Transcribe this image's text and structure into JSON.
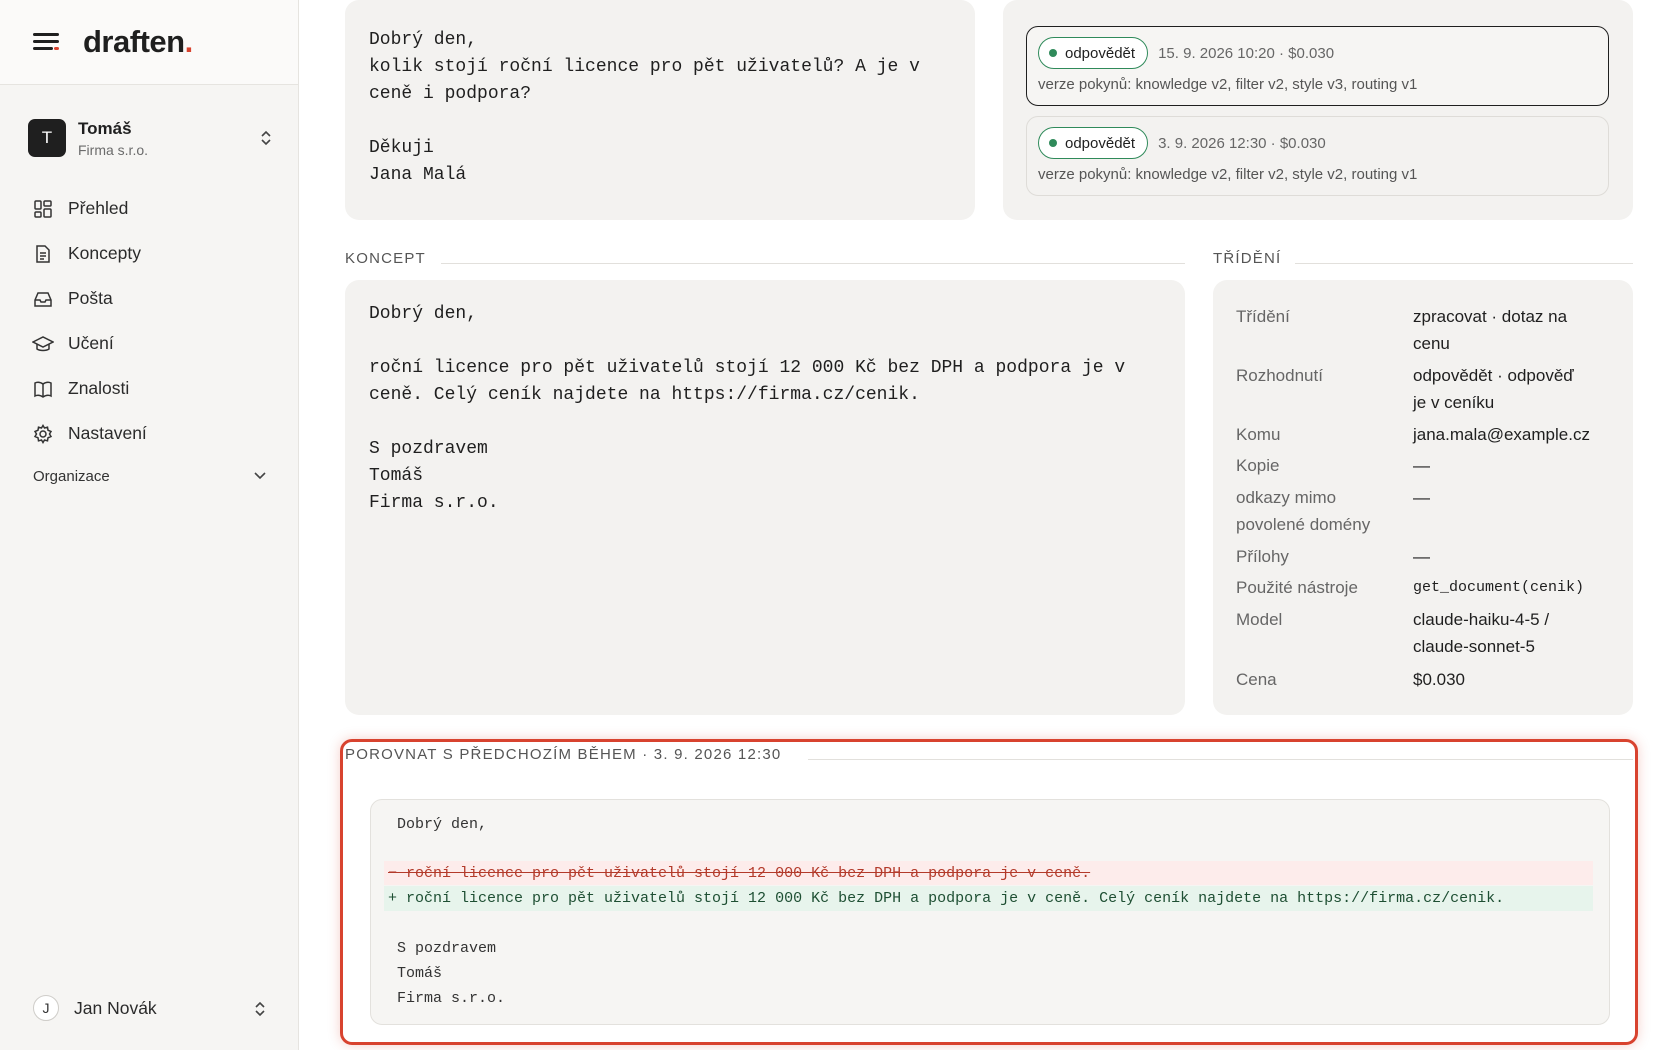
{
  "app": {
    "logo": "draften",
    "logo_dot": "."
  },
  "org": {
    "initial": "T",
    "name": "Tomáš",
    "company": "Firma s.r.o."
  },
  "nav": [
    {
      "label": "Přehled",
      "icon": "dashboard-icon"
    },
    {
      "label": "Koncepty",
      "icon": "document-icon"
    },
    {
      "label": "Pošta",
      "icon": "inbox-icon"
    },
    {
      "label": "Učení",
      "icon": "graduation-cap-icon"
    },
    {
      "label": "Znalosti",
      "icon": "book-icon"
    },
    {
      "label": "Nastavení",
      "icon": "gear-icon"
    }
  ],
  "organizace": "Organizace",
  "user": {
    "initial": "J",
    "name": "Jan Novák"
  },
  "email": {
    "body": "Dobrý den,\nkolik stojí roční licence pro pět uživatelů? A je v\nceně i podpora?\n\nDěkuji\nJana Malá"
  },
  "runs": [
    {
      "status": "odpovědět",
      "meta": "15. 9. 2026 10:20 · $0.030",
      "versions": "verze pokynů: knowledge v2, filter v2, style v3, routing v1"
    },
    {
      "status": "odpovědět",
      "meta": "3. 9. 2026 12:30 · $0.030",
      "versions": "verze pokynů: knowledge v2, filter v2, style v2, routing v1"
    }
  ],
  "koncept": {
    "label": "KONCEPT",
    "body": "Dobrý den,\n\nroční licence pro pět uživatelů stojí 12 000 Kč bez DPH a podpora je v\nceně. Celý ceník najdete na https://firma.cz/cenik.\n\nS pozdravem\nTomáš\nFirma s.r.o."
  },
  "trideni": {
    "label": "TŘÍDĚNÍ",
    "rows": [
      {
        "key": "Třídění",
        "value_l1": "zpracovat · dotaz na",
        "value_l2": "cenu"
      },
      {
        "key": "Rozhodnutí",
        "value_l1": "odpovědět · odpověď",
        "value_l2": "je v ceníku"
      },
      {
        "key": "Komu",
        "value_l1": "jana.mala@example.cz"
      },
      {
        "key": "Kopie",
        "value_l1": "—"
      },
      {
        "key_l1": "odkazy mimo",
        "key_l2": "povolené domény",
        "value_l1": "—"
      },
      {
        "key": "Přílohy",
        "value_l1": "—"
      },
      {
        "key": "Použité nástroje",
        "value_l1": "get_document(cenik)"
      },
      {
        "key": "Model",
        "value_l1": "claude-haiku-4-5 /",
        "value_l2": "claude-sonnet-5"
      },
      {
        "key": "Cena",
        "value_l1": "$0.030"
      }
    ]
  },
  "compare": {
    "label": "POROVNAT S PŘEDCHOZÍM BĚHEM · 3. 9. 2026 12:30",
    "greeting": "Dobrý den,",
    "removed": "− roční licence pro pět uživatelů stojí 12 000 Kč bez DPH a podpora je v ceně.",
    "added": "+ roční licence pro pět uživatelů stojí 12 000 Kč bez DPH a podpora je v ceně. Celý ceník najdete na https://firma.cz/cenik.",
    "sign1": "S pozdravem",
    "sign2": "Tomáš",
    "sign3": "Firma s.r.o."
  },
  "colors": {
    "accent": "#d8432f",
    "status_green": "#2f8a5a",
    "card_bg": "#f3f2f0"
  }
}
